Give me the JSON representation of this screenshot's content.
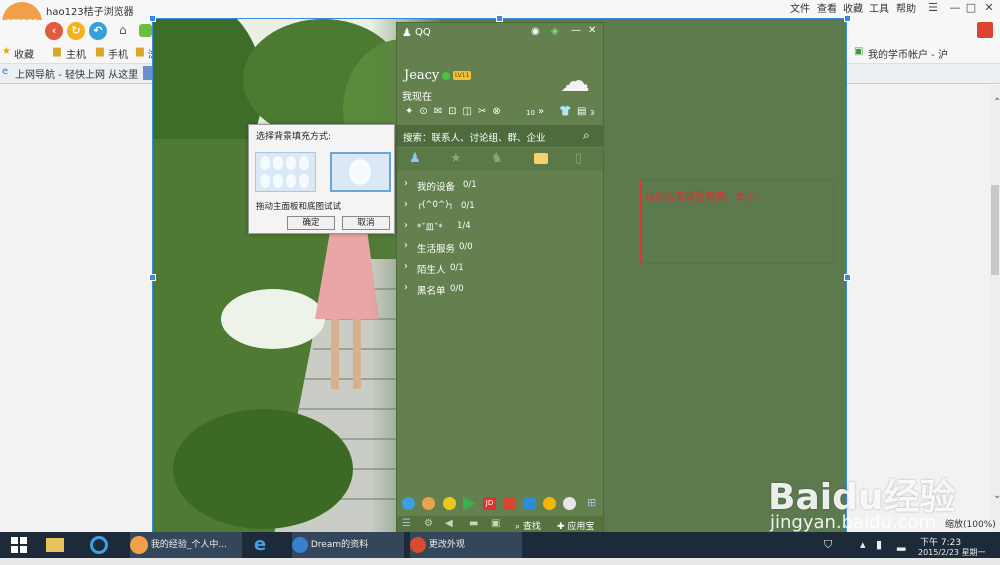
{
  "browser": {
    "title": "hao123桔子浏览器",
    "logo_text": "orange",
    "menu": [
      "文件",
      "查看",
      "收藏",
      "工具",
      "帮助"
    ],
    "window_buttons": [
      "☰",
      "—",
      "□",
      "✕"
    ],
    "favorites": [
      {
        "label": "收藏"
      },
      {
        "label": "主机"
      },
      {
        "label": "手机"
      },
      {
        "label": "浏览"
      },
      {
        "label": "我的学币帐户 - 沪"
      }
    ],
    "tabs": [
      {
        "label": "上网导航 - 轻快上网 从这里"
      }
    ],
    "zoom": "缩放(100%)",
    "accent": "#3a8be0"
  },
  "qq": {
    "app_name": "QQ",
    "nickname": "Jeacy",
    "level_badge": "LV11",
    "status": "我现在",
    "toolbar_count_1": "10",
    "toolbar_count_2": "3",
    "search_placeholder": "搜索：联系人、讨论组、群、企业",
    "groups": [
      {
        "name": "我的设备",
        "count": "0/1"
      },
      {
        "name": "┌(^0^)┐",
        "count": "0/1"
      },
      {
        "name": "*ˇ皿ˇ*",
        "count": "1/4"
      },
      {
        "name": "生活服务",
        "count": "0/0"
      },
      {
        "name": "陌生人",
        "count": "0/1"
      },
      {
        "name": "黑名单",
        "count": "0/0"
      }
    ],
    "bottom_find": "查找",
    "bottom_app": "应用宝",
    "panel_color": "#64804f"
  },
  "dialog": {
    "title": "选择背景填充方式:",
    "hint": "拖动主面板和底图试试",
    "ok": "确定",
    "cancel": "取消"
  },
  "annotation": {
    "text": "拉动边宽设置宽度、大小。",
    "color": "#d33333"
  },
  "taskbar": {
    "items": [
      {
        "label": "我的经验_个人中..."
      },
      {
        "label": "Dream的资料"
      },
      {
        "label": "更改外观"
      }
    ],
    "time": "下午 7:23",
    "date": "2015/2/23 星期一"
  },
  "watermark": {
    "brand": "Baidu经验",
    "url": "jingyan.baidu.com"
  }
}
